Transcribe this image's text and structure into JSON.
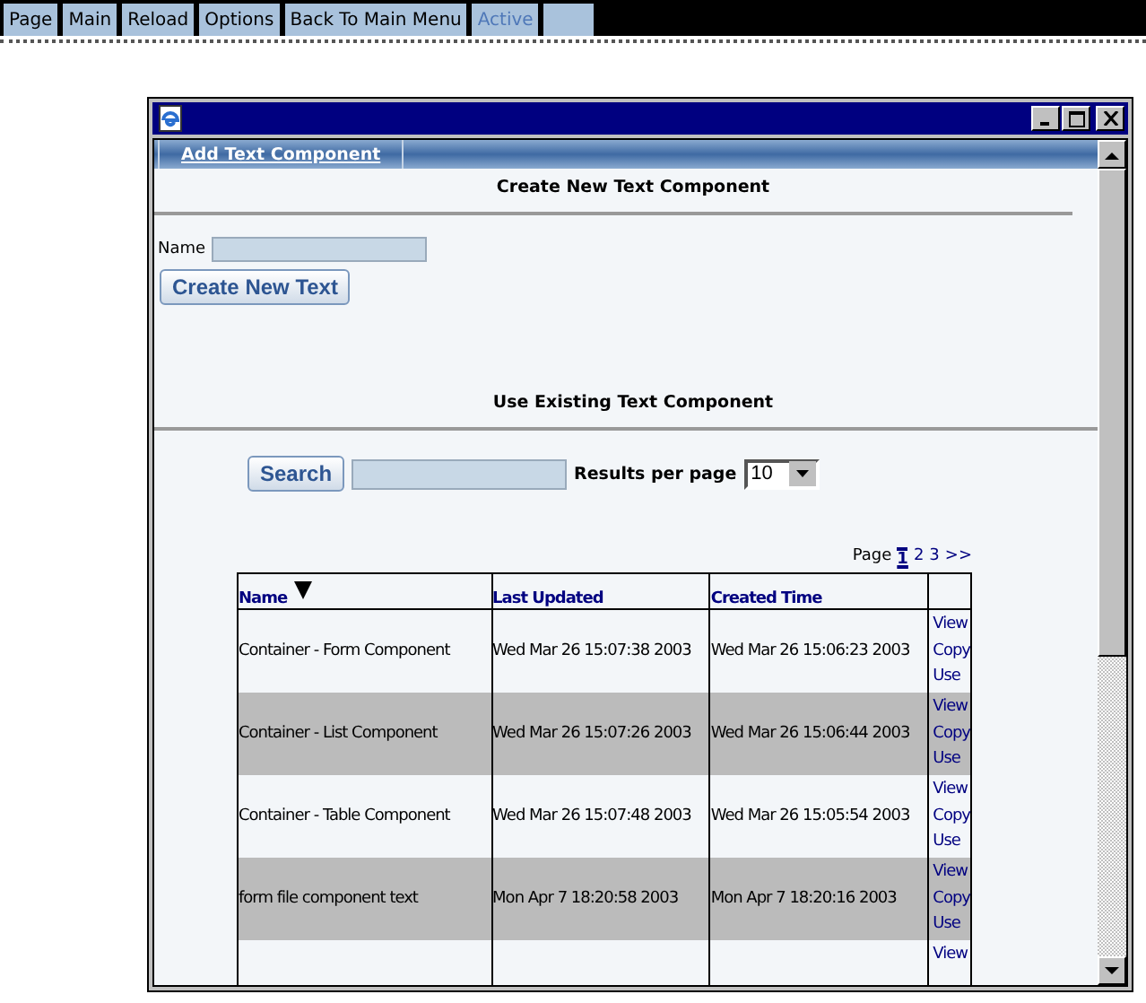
{
  "menu": [
    {
      "label": "Page",
      "selected": false
    },
    {
      "label": "Main",
      "selected": false
    },
    {
      "label": "Reload",
      "selected": false
    },
    {
      "label": "Options",
      "selected": false
    },
    {
      "label": "Back To Main Menu",
      "selected": false
    },
    {
      "label": "Active",
      "selected": true
    }
  ],
  "tabs": [
    {
      "label": "Add Text Component",
      "selected": true
    }
  ],
  "create_section": {
    "title": "Create New Text Component",
    "name_label": "Name",
    "button": "Create New Text"
  },
  "existing_section": {
    "title": "Use Existing Text Component",
    "search_button": "Search",
    "results_label": "Results per page",
    "results_per_page": "10"
  },
  "pagination": {
    "label": "Page",
    "pages": [
      {
        "label": "1",
        "selected": true
      },
      {
        "label": "2",
        "selected": false
      },
      {
        "label": "3",
        "selected": false
      }
    ],
    "next": ">>"
  },
  "table": {
    "columns": [
      {
        "label": "Name",
        "sorted": true
      },
      {
        "label": "Last Updated",
        "sorted": false
      },
      {
        "label": "Created Time",
        "sorted": false
      }
    ],
    "rows": [
      {
        "name": "Container - Form Component",
        "last_updated": "Wed Mar 26 15:07:38 2003",
        "created": "Wed Mar 26 15:06:23 2003",
        "actions": [
          "View",
          "Copy",
          "Use"
        ]
      },
      {
        "name": "Container - List Component",
        "last_updated": "Wed Mar 26 15:07:26 2003",
        "created": "Wed Mar 26 15:06:44 2003",
        "actions": [
          "View",
          "Copy",
          "Use"
        ]
      },
      {
        "name": "Container - Table Component",
        "last_updated": "Wed Mar 26 15:07:48 2003",
        "created": "Wed Mar 26 15:05:54 2003",
        "actions": [
          "View",
          "Copy",
          "Use"
        ]
      },
      {
        "name": "form file component text",
        "last_updated": "Mon Apr 7 18:20:58 2003",
        "created": "Mon Apr 7 18:20:16 2003",
        "actions": [
          "View",
          "Copy",
          "Use"
        ]
      },
      {
        "name": "",
        "last_updated": "",
        "created": "",
        "actions": [
          "View"
        ]
      }
    ]
  }
}
